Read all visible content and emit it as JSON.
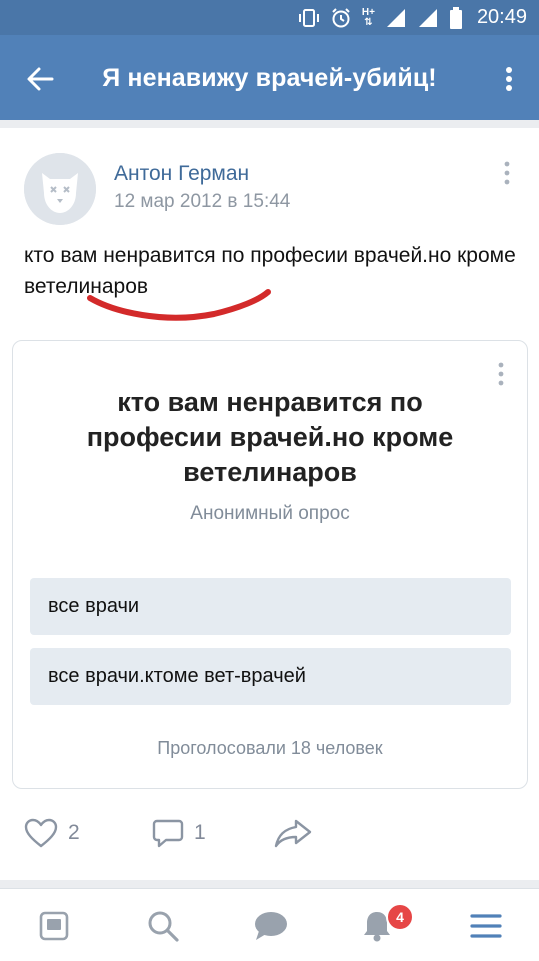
{
  "status_bar": {
    "time": "20:49",
    "icons": [
      "vibrate-icon",
      "alarm-icon",
      "h-plus-signal-icon",
      "signal-icon",
      "battery-icon"
    ],
    "network_label": "H+"
  },
  "header": {
    "title": "Я ненавижу врачей-убийц!",
    "back_icon": "arrow-left-icon",
    "menu_icon": "more-vertical-icon"
  },
  "post": {
    "author": "Антон Герман",
    "date": "12 мар 2012 в 15:44",
    "text": "кто вам ненравится по професии врачей.но кроме ветелинаров",
    "poll": {
      "question": "кто вам ненравится по професии врачей.но кроме ветелинаров",
      "type": "Анонимный опрос",
      "options": [
        {
          "label": "все врачи"
        },
        {
          "label": "все врачи.ктоме вет-врачей"
        }
      ],
      "votes": "Проголосовали 18 человек"
    },
    "actions": {
      "likes": "2",
      "comments": "1"
    }
  },
  "bottom_nav": {
    "items": [
      "news-icon",
      "search-icon",
      "messages-icon",
      "notifications-icon",
      "menu-icon"
    ],
    "notifications_badge": "4"
  },
  "colors": {
    "header": "#5181b8",
    "status_bar": "#4a76a8",
    "author_link": "#3f6a99",
    "option_bg": "#e5ebf1",
    "scribble": "#d32a2a",
    "badge": "#e64646"
  }
}
